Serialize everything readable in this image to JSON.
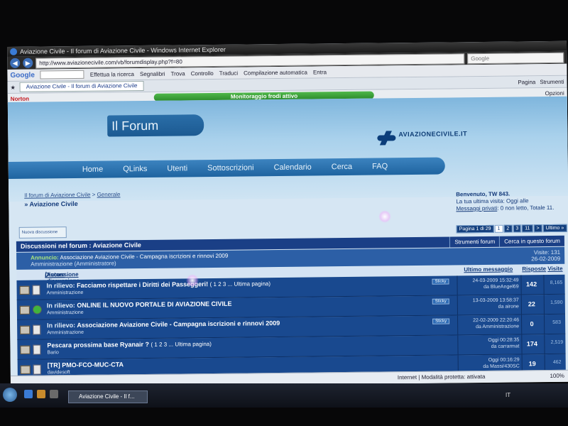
{
  "window": {
    "title": "Aviazione Civile - Il forum di Aviazione Civile - Windows Internet Explorer",
    "url": "http://www.aviazionecivile.com/vb/forumdisplay.php?f=80",
    "search_engine": "Google"
  },
  "google_toolbar": {
    "logo": "Google",
    "search_btn": "Effettua la ricerca",
    "bookmarks": "Segnalibri",
    "find": "Trova",
    "check": "Controllo",
    "translate": "Traduci",
    "fill": "Compilazione automatica",
    "entra": "Entra"
  },
  "tab": {
    "label": "Aviazione Civile - Il forum di Aviazione Civile",
    "page": "Pagina",
    "tools": "Strumenti"
  },
  "norton": {
    "label": "Norton",
    "fraud": "Monitoraggio frodi attivo",
    "options": "Opzioni"
  },
  "site": {
    "title": "Il Forum",
    "brand": "AVIAZIONECIVILE.IT",
    "nav": [
      "Home",
      "QLinks",
      "Utenti",
      "Sottoscrizioni",
      "Calendario",
      "Cerca",
      "FAQ"
    ]
  },
  "breadcrumb": {
    "root": "Il forum di Aviazione Civile",
    "sep": ">",
    "parent": "Generale",
    "current": "Aviazione Civile"
  },
  "welcome": {
    "greeting": "Benvenuto, TW 843.",
    "last_visit": "La tua ultima visita: Oggi alle",
    "pm_link": "Messaggi privati",
    "pm_text": ": 0 non letto, Totale 11."
  },
  "new_thread": "Nuova discussione",
  "pager": {
    "label": "Pagina 1 di 29",
    "pages": [
      "1",
      "2",
      "3",
      "11",
      ">",
      "Ultimo »"
    ],
    "current": "1"
  },
  "forum_bar": {
    "title": "Discussioni nel forum",
    "forum_name": "Aviazione Civile",
    "tools": "Strumenti forum",
    "search": "Cerca in questo forum"
  },
  "announcement": {
    "label": "Annuncio:",
    "title": "Associazione Aviazione Civile - Campagna iscrizioni e rinnovi 2009",
    "author": "Amministrazione (Amministratore)",
    "visits": "Visite: 131",
    "date": "26-02-2009"
  },
  "columns": {
    "thread": "Discussione",
    "author": "Autore discussione",
    "last": "Ultimo messaggio",
    "replies": "Risposte",
    "views": "Visite"
  },
  "threads": [
    {
      "prefix": "In rilievo:",
      "title": "Facciamo rispettare i Diritti dei Passeggeri!",
      "pages": "( 1 2 3 ... Ultima pagina)",
      "author": "Amministrazione",
      "sticky": "Sticky",
      "last_date": "24-03-2009 15:32:49",
      "last_by": "da BlueAngel69",
      "replies": "142",
      "views": "8,165"
    },
    {
      "prefix": "In rilievo:",
      "title": "ONLINE IL NUOVO PORTALE DI AVIAZIONE CIVILE",
      "pages": "",
      "author": "Amministrazione",
      "sticky": "Sticky",
      "last_date": "13-03-2009 13:58:37",
      "last_by": "da airone",
      "replies": "22",
      "views": "1,590"
    },
    {
      "prefix": "In rilievo:",
      "title": "Associazione Aviazione Civile - Campagna iscrizioni e rinnovi 2009",
      "pages": "",
      "author": "Amministrazione",
      "sticky": "Sticky",
      "last_date": "22-02-2009 22:20:46",
      "last_by": "da Amministrazione",
      "replies": "0",
      "views": "583"
    },
    {
      "prefix": "",
      "title": "Pescara prossima base Ryanair ?",
      "pages": "( 1 2 3 ... Ultima pagina)",
      "author": "Bario",
      "sticky": "",
      "last_date": "Oggi 00:28:35",
      "last_by": "da carrarmat",
      "replies": "174",
      "views": "2,519"
    },
    {
      "prefix": "",
      "title": "[TR] PMO-FCO-MUC-CTA",
      "pages": "",
      "author": "davidesoft",
      "sticky": "",
      "last_date": "Oggi 00:16:29",
      "last_by": "da Massi/430SC",
      "replies": "19",
      "views": "462"
    }
  ],
  "status": {
    "text": "Internet | Modalità protetta: attivata",
    "zoom": "100%"
  },
  "taskbar": {
    "task": "Aviazione Civile - Il f...",
    "lang": "IT"
  }
}
